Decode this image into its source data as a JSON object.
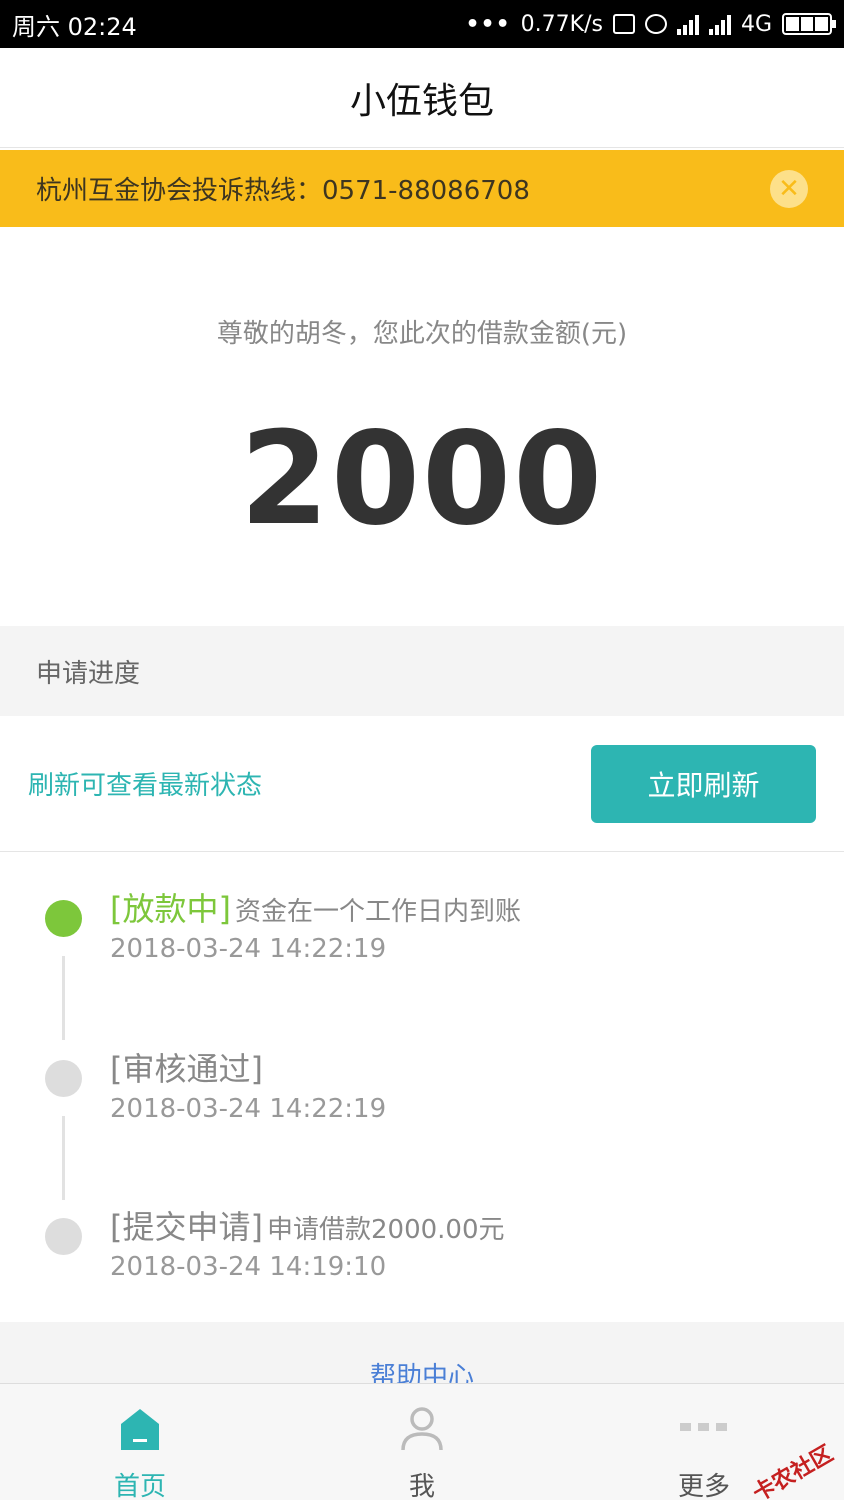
{
  "status_bar": {
    "time": "周六 02:24",
    "net_speed": "0.77K/s",
    "network": "4G"
  },
  "header": {
    "title": "小伍钱包"
  },
  "notice": {
    "text": "杭州互金协会投诉热线：0571-88086708",
    "close_icon": "close-icon"
  },
  "amount": {
    "label": "尊敬的胡冬，您此次的借款金额(元)",
    "value": "2000"
  },
  "progress": {
    "header": "申请进度",
    "refresh_hint": "刷新可查看最新状态",
    "refresh_button": "立即刷新"
  },
  "timeline": [
    {
      "tag": "[放款中]",
      "desc": "资金在一个工作日内到账",
      "time": "2018-03-24 14:22:19",
      "active": true
    },
    {
      "tag": "[审核通过]",
      "desc": "",
      "time": "2018-03-24 14:22:19",
      "active": false
    },
    {
      "tag": "[提交申请]",
      "desc": "申请借款2000.00元",
      "time": "2018-03-24 14:19:10",
      "active": false
    }
  ],
  "help": {
    "label": "帮助中心"
  },
  "tabbar": {
    "home": "首页",
    "me": "我",
    "more": "更多"
  },
  "watermark": "卡农社区",
  "colors": {
    "accent": "#2db5b2",
    "notice_bg": "#f9bc1a",
    "active_green": "#7dc73b",
    "link_blue": "#4a7fd6"
  }
}
